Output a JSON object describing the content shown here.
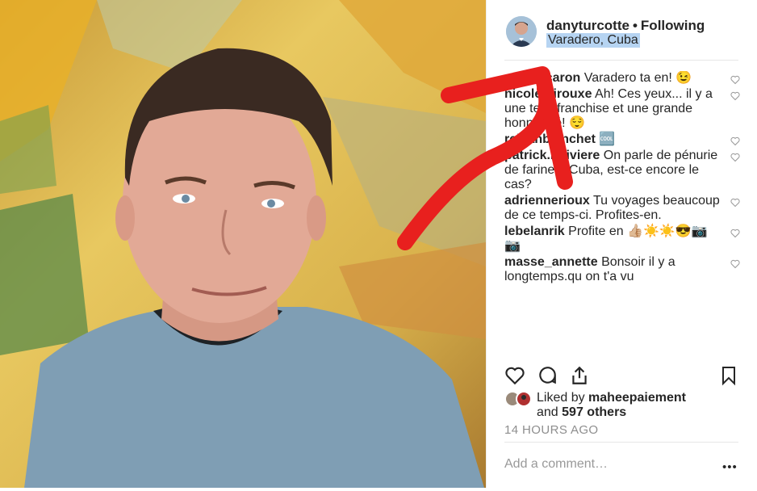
{
  "post": {
    "username": "danyturcotte",
    "separator": "•",
    "follow_status": "Following",
    "location": "Varadero, Cuba"
  },
  "comments": [
    {
      "user": "michelcaron",
      "text": "Varadero ta",
      "text2": "en! 😉"
    },
    {
      "user": "nicole.girouxe",
      "text": "Ah! Ces yeux... il y a une telle franchise et une grande honnêteté! 😌"
    },
    {
      "user": "rejeanblanchet",
      "text": "🆒"
    },
    {
      "user": "patrick.lariviere",
      "text": "On parle de pénurie de farine à Cuba, est-ce encore le cas?"
    },
    {
      "user": "adriennerioux",
      "text": "Tu voyages beaucoup de ce temps-ci. Profites-en."
    },
    {
      "user": "lebelanrik",
      "text": "Profite en 👍🏼☀️☀️😎📷📷"
    },
    {
      "user": "masse_annette",
      "text": "Bonsoir il y a longtemps.qu on t'a vu"
    }
  ],
  "likes": {
    "prefix": "Liked by",
    "first_user": "maheepaiement",
    "and": "and",
    "others": "597 others"
  },
  "timestamp": "14 HOURS AGO",
  "add_comment_placeholder": "Add a comment…",
  "more_label": "•••",
  "icons": [
    "heart-icon",
    "comment-icon",
    "share-icon",
    "bookmark-icon",
    "more-options-icon"
  ],
  "colors": {
    "annotation_arrow": "#e8201e",
    "location_highlight": "#b6d4f2"
  }
}
